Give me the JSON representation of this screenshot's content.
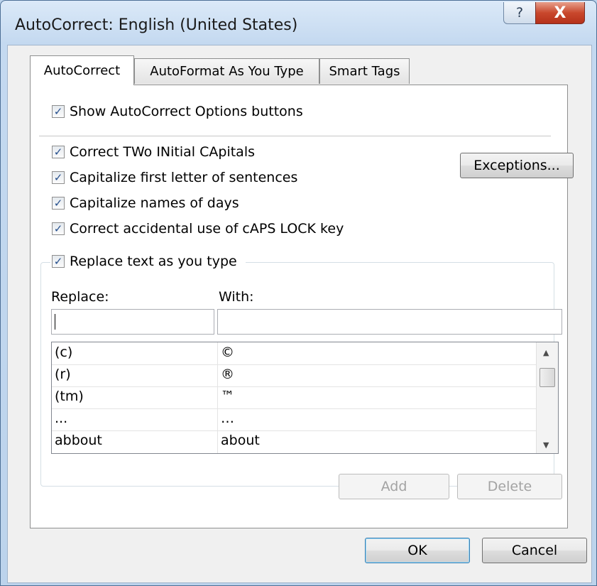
{
  "window": {
    "title": "AutoCorrect: English (United States)",
    "help_icon": "?",
    "close_icon": "X"
  },
  "tabs": [
    {
      "label": "AutoCorrect",
      "active": true
    },
    {
      "label": "AutoFormat As You Type",
      "active": false
    },
    {
      "label": "Smart Tags",
      "active": false
    }
  ],
  "options": {
    "show_buttons": "Show AutoCorrect Options buttons",
    "two_initial": "Correct TWo INitial CApitals",
    "first_letter": "Capitalize first letter of sentences",
    "days": "Capitalize names of days",
    "caps_lock": "Correct accidental use of cAPS LOCK key",
    "replace_text": "Replace text as you type",
    "check": "✓"
  },
  "buttons": {
    "exceptions": "Exceptions...",
    "add": "Add",
    "delete": "Delete",
    "ok": "OK",
    "cancel": "Cancel"
  },
  "replace": {
    "replace_label": "Replace:",
    "with_label": "With:",
    "replace_value": "",
    "with_value": ""
  },
  "entries": [
    {
      "replace": "(c)",
      "with": "©"
    },
    {
      "replace": "(r)",
      "with": "®"
    },
    {
      "replace": "(tm)",
      "with": "™"
    },
    {
      "replace": "...",
      "with": "…"
    },
    {
      "replace": "abbout",
      "with": "about"
    }
  ],
  "scroll": {
    "up": "▲",
    "down": "▼"
  }
}
